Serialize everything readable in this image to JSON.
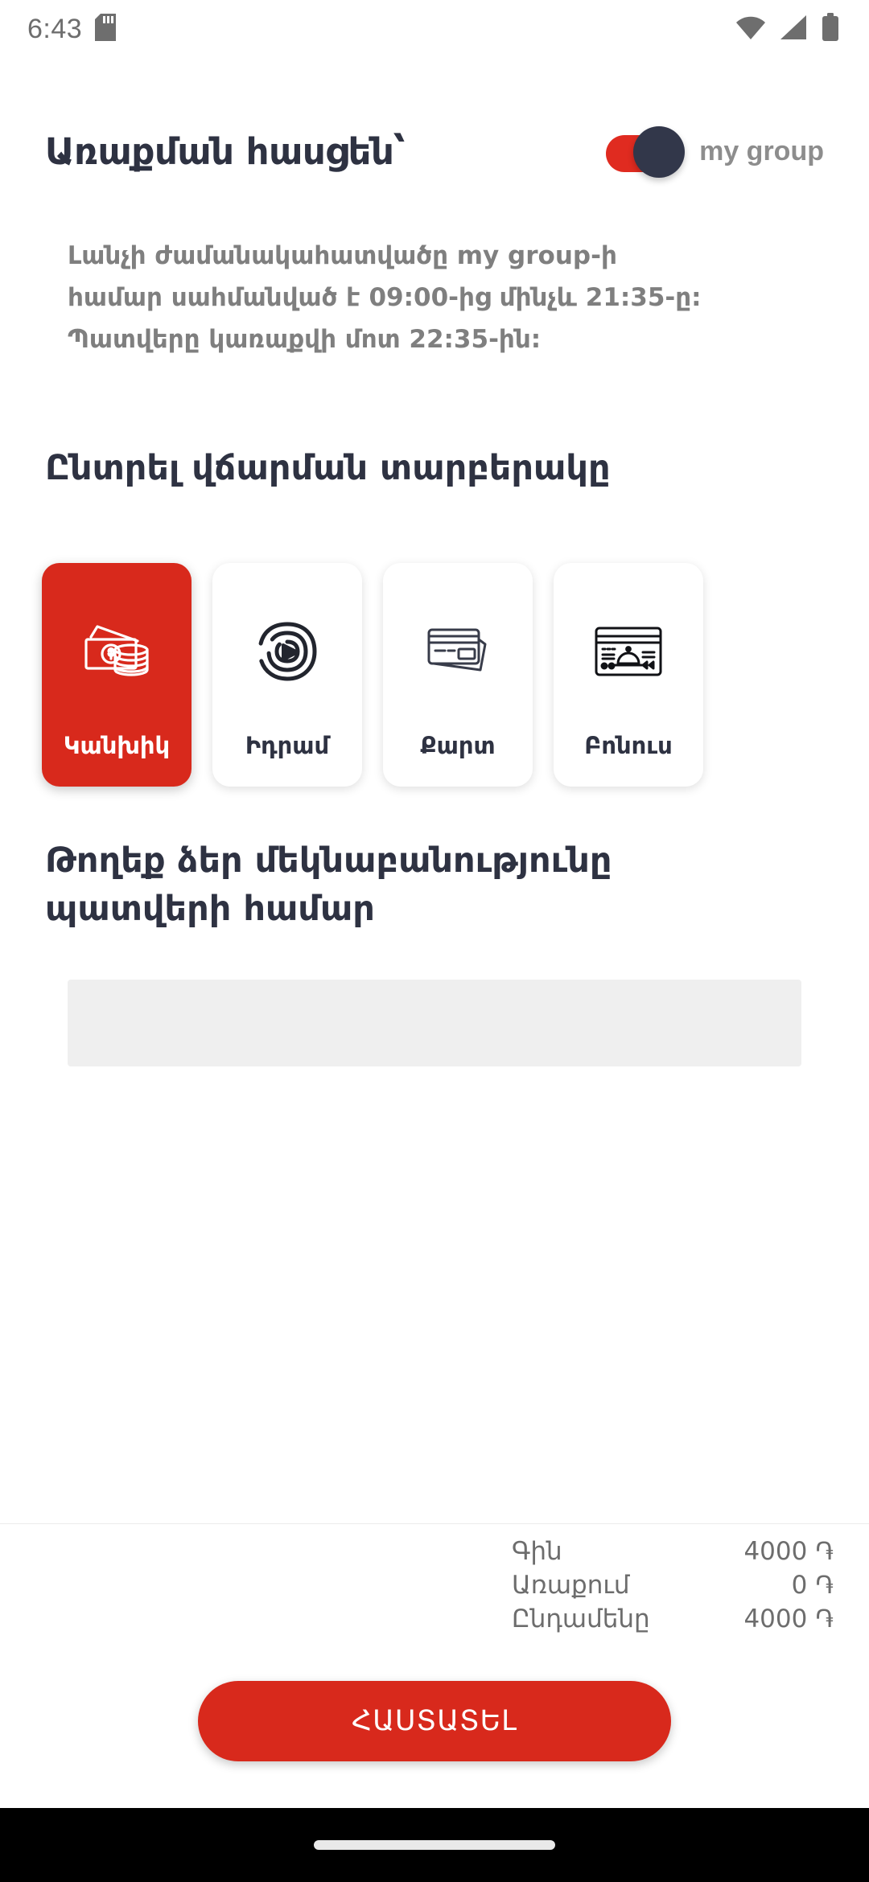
{
  "statusbar": {
    "time": "6:43",
    "icons": [
      "sd-card-icon",
      "wifi-icon",
      "cellular-signal-icon",
      "battery-icon"
    ]
  },
  "header": {
    "title": "Առաքման հասցեն՝",
    "brand_name": "my group",
    "brand_colors": {
      "pill": "#e02b20",
      "dot": "#32374a"
    }
  },
  "description": {
    "line1": "Լանչի ժամանակահատվածը my group-ի",
    "line2": "համար սահմանված է 09:00-ից մինչև 21:35-ը:",
    "line3": "Պատվերը կառաքվի մոտ 22:35-ին:"
  },
  "payment": {
    "heading": "Ընտրել վճարման տարբերակը",
    "selected_index": 0,
    "accent_color": "#d8291c",
    "options": [
      {
        "label": "Կանխիկ",
        "icon": "banknote-coins-icon",
        "selected": true
      },
      {
        "label": "Իդրամ",
        "icon": "idram-logo-icon",
        "selected": false
      },
      {
        "label": "Քարտ",
        "icon": "credit-cards-icon",
        "selected": false
      },
      {
        "label": "Բոնուս",
        "icon": "bonus-food-card-icon",
        "selected": false
      }
    ]
  },
  "comment": {
    "heading_line1": "Թողեք ձեր մեկնաբանությունը",
    "heading_line2": "պատվերի համար",
    "value": "",
    "placeholder": ""
  },
  "summary": {
    "rows": [
      {
        "label": "Գին",
        "value": "4000 ֏"
      },
      {
        "label": "Առաքում",
        "value": "0 ֏"
      },
      {
        "label": "Ընդամենը",
        "value": "4000 ֏"
      }
    ]
  },
  "footer": {
    "confirm_label": "ՀԱՍՏԱՏԵԼ"
  }
}
